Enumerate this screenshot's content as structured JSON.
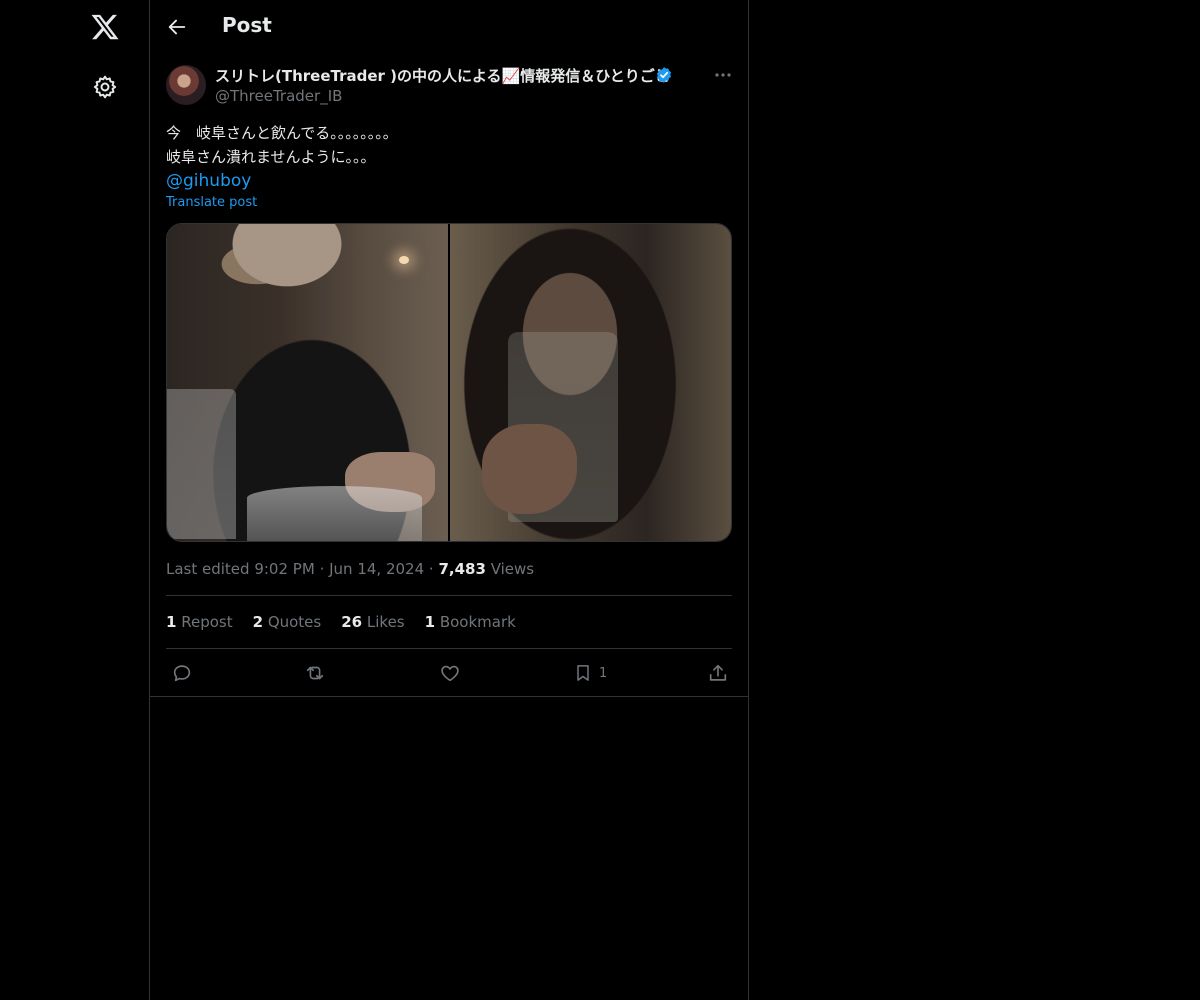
{
  "header": {
    "title": "Post"
  },
  "post": {
    "author": {
      "display_name": "スリトレ(ThreeTrader )の中の人による📈情報発信＆ひとりごと",
      "handle": "@ThreeTrader_IB",
      "verified": true
    },
    "text_lines": [
      "今　岐阜さんと飲んでる。。。。。。。。",
      "岐阜さん潰れませんように。。。"
    ],
    "mention": "@gihuboy",
    "translate_label": "Translate post",
    "meta": {
      "edited_label": "Last edited 9:02 PM",
      "date": "Jun 14, 2024",
      "views_count": "7,483",
      "views_label": "Views"
    },
    "stats": [
      {
        "count": "1",
        "label": "Repost"
      },
      {
        "count": "2",
        "label": "Quotes"
      },
      {
        "count": "26",
        "label": "Likes"
      },
      {
        "count": "1",
        "label": "Bookmark"
      }
    ],
    "actions": {
      "bookmark_count": "1"
    }
  },
  "icons": {
    "logo": "x-logo-icon",
    "settings": "gear-icon",
    "back": "arrow-left-icon",
    "verified": "verified-badge-icon",
    "more": "more-horizontal-icon",
    "reply": "reply-icon",
    "repost": "repost-icon",
    "like": "heart-icon",
    "bookmark": "bookmark-icon",
    "share": "share-icon"
  },
  "colors": {
    "background": "#000000",
    "text": "#e7e9ea",
    "secondary": "#71767b",
    "accent": "#1d9bf0",
    "border": "#2f3336"
  }
}
